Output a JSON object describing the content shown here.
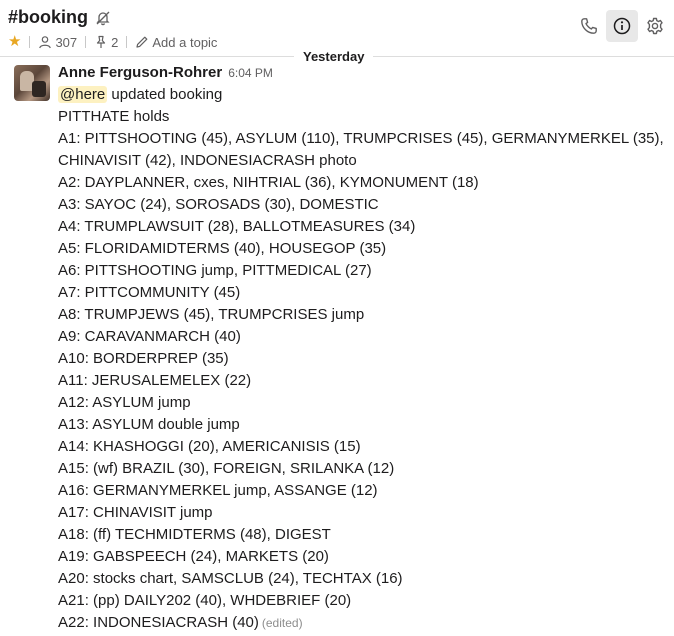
{
  "header": {
    "channel": "#booking",
    "members_count": "307",
    "pins_count": "2",
    "topic_placeholder": "Add a topic"
  },
  "icons": {
    "mute": "bell-slash-icon",
    "star": "star-icon",
    "members": "person-icon",
    "pins": "pin-icon",
    "topic": "pencil-icon",
    "call": "phone-icon",
    "details": "info-icon",
    "settings": "gear-icon"
  },
  "colors": {
    "star": "#e8a723",
    "mention_bg": "#fdf1c1",
    "divider": "#dddddd"
  },
  "day_divider": "Yesterday",
  "message": {
    "author": "Anne Ferguson-Rohrer",
    "time": "6:04 PM",
    "mention": "@here",
    "first_line_rest": " updated booking",
    "lines": [
      "PITTHATE holds",
      "A1: PITTSHOOTING (45), ASYLUM (110), TRUMPCRISES (45), GERMANYMERKEL (35),",
      "CHINAVISIT (42), INDONESIACRASH photo",
      "A2: DAYPLANNER, cxes, NIHTRIAL (36), KYMONUMENT (18)",
      "A3: SAYOC (24), SOROSADS (30), DOMESTIC",
      "A4: TRUMPLAWSUIT (28), BALLOTMEASURES (34)",
      "A5: FLORIDAMIDTERMS (40), HOUSEGOP (35)",
      "A6: PITTSHOOTING jump, PITTMEDICAL (27)",
      "A7: PITTCOMMUNITY (45)",
      "A8: TRUMPJEWS (45), TRUMPCRISES jump",
      "A9: CARAVANMARCH (40)",
      "A10: BORDERPREP (35)",
      "A11: JERUSALEMELEX (22)",
      "A12: ASYLUM jump",
      "A13: ASYLUM double jump",
      "A14: KHASHOGGI (20), AMERICANISIS (15)",
      "A15: (wf) BRAZIL (30), FOREIGN, SRILANKA (12)",
      "A16: GERMANYMERKEL jump, ASSANGE (12)",
      "A17: CHINAVISIT jump",
      "A18: (ff) TECHMIDTERMS (48), DIGEST",
      "A19: GABSPEECH (24), MARKETS (20)",
      "A20: stocks chart, SAMSCLUB (24), TECHTAX (16)",
      "A21: (pp) DAILY202 (40), WHDEBRIEF (20)"
    ],
    "last_line": "A22: INDONESIACRASH (40)",
    "edited_label": "(edited)"
  }
}
